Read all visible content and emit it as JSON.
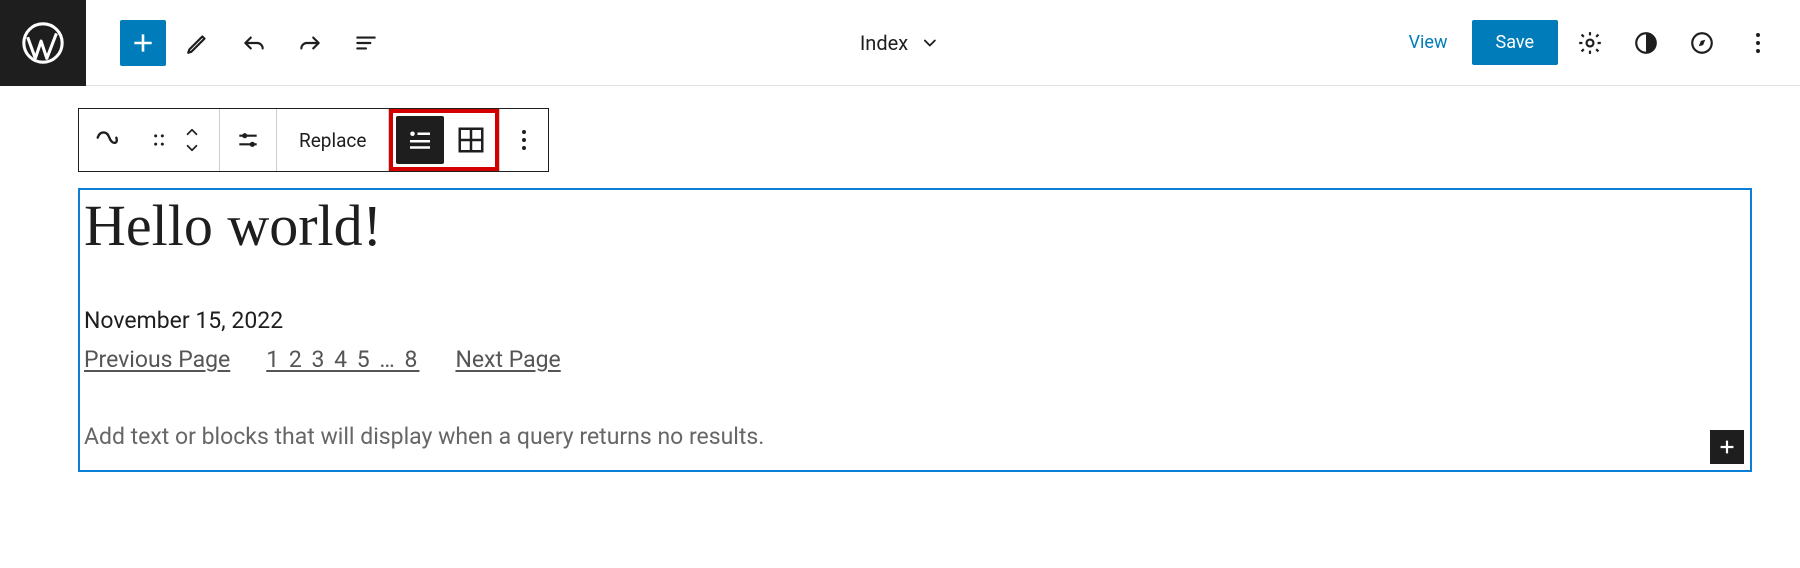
{
  "header": {
    "template_label": "Index",
    "view_label": "View",
    "save_label": "Save"
  },
  "block_toolbar": {
    "replace_label": "Replace"
  },
  "query": {
    "post_title": "Hello world!",
    "post_date": "November 15, 2022",
    "prev_label": "Previous Page",
    "next_label": "Next Page",
    "page_numbers": "1 2 3 4 5 … 8",
    "no_results_placeholder": "Add text or blocks that will display when a query returns no results."
  }
}
